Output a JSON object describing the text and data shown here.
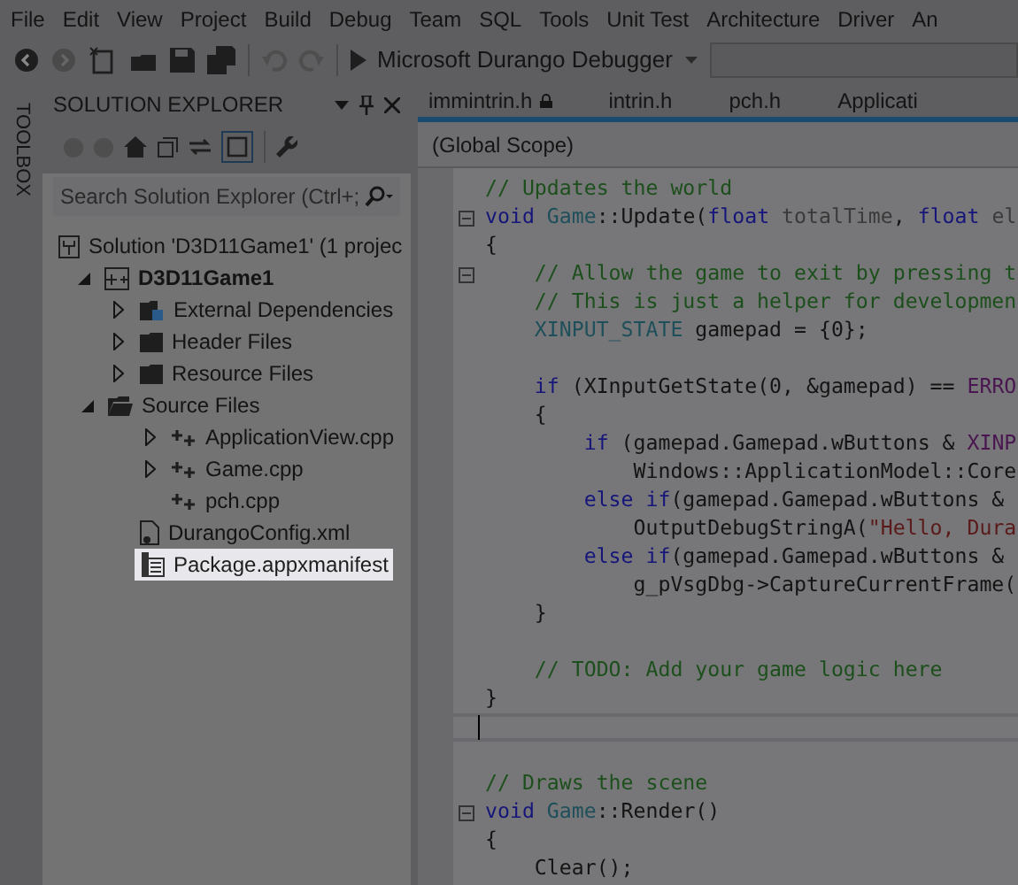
{
  "menu": [
    "File",
    "Edit",
    "View",
    "Project",
    "Build",
    "Debug",
    "Team",
    "SQL",
    "Tools",
    "Unit Test",
    "Architecture",
    "Driver",
    "An"
  ],
  "toolbar": {
    "debugger": "Microsoft Durango Debugger"
  },
  "toolbox": {
    "label": "TOOLBOX"
  },
  "solution_explorer": {
    "title": "SOLUTION EXPLORER",
    "search": {
      "placeholder": "Search Solution Explorer (Ctrl+;"
    },
    "tree": [
      {
        "kind": "solution",
        "label": "Solution 'D3D11Game1' (1 projec",
        "selected": false
      },
      {
        "kind": "project",
        "label": "D3D11Game1",
        "expanded": true,
        "selected": false,
        "children": [
          {
            "kind": "refs",
            "label": "External Dependencies",
            "expanded": false,
            "selected": false
          },
          {
            "kind": "folder",
            "label": "Header Files",
            "expanded": false,
            "selected": false
          },
          {
            "kind": "folder",
            "label": "Resource Files",
            "expanded": false,
            "selected": false
          },
          {
            "kind": "folder",
            "label": "Source Files",
            "expanded": true,
            "selected": false,
            "children": [
              {
                "kind": "cpp",
                "label": "ApplicationView.cpp",
                "expanded": false,
                "selected": false
              },
              {
                "kind": "cpp",
                "label": "Game.cpp",
                "expanded": false,
                "selected": false
              },
              {
                "kind": "cpp",
                "label": "pch.cpp",
                "selected": false
              }
            ]
          },
          {
            "kind": "xml",
            "label": "DurangoConfig.xml",
            "selected": false
          },
          {
            "kind": "manifest",
            "label": "Package.appxmanifest",
            "selected": true
          }
        ]
      }
    ]
  },
  "editor": {
    "tabs": [
      {
        "label": "immintrin.h",
        "locked": true
      },
      {
        "label": "intrin.h",
        "locked": false
      },
      {
        "label": "pch.h",
        "locked": false
      },
      {
        "label": "Applicati",
        "locked": false
      }
    ],
    "scope": "(Global Scope)",
    "lines": [
      {
        "fold": false,
        "tokens": [
          {
            "kind": "comment",
            "text": "// Updates the world"
          }
        ]
      },
      {
        "fold": true,
        "tokens": [
          {
            "kind": "keyword",
            "text": "void"
          },
          {
            "kind": "type",
            "text": " Game"
          },
          {
            "kind": "plain",
            "text": "::Update("
          },
          {
            "kind": "keyword",
            "text": "float"
          },
          {
            "kind": "param",
            "text": " totalTime"
          },
          {
            "kind": "plain",
            "text": ", "
          },
          {
            "kind": "keyword",
            "text": "float"
          },
          {
            "kind": "param",
            "text": " el"
          }
        ]
      },
      {
        "fold": false,
        "tokens": [
          {
            "kind": "plain",
            "text": "{"
          }
        ]
      },
      {
        "fold": true,
        "tokens": [
          {
            "kind": "comment",
            "text": "    // Allow the game to exit by pressing t"
          }
        ]
      },
      {
        "fold": false,
        "tokens": [
          {
            "kind": "comment",
            "text": "    // This is just a helper for developmen"
          }
        ]
      },
      {
        "fold": false,
        "tokens": [
          {
            "kind": "type",
            "text": "    XINPUT_STATE"
          },
          {
            "kind": "plain",
            "text": " gamepad = {0};"
          }
        ]
      },
      {
        "fold": false
      },
      {
        "fold": false,
        "tokens": [
          {
            "kind": "keyword",
            "text": "    if"
          },
          {
            "kind": "plain",
            "text": " (XInputGetState(0, &gamepad) == "
          },
          {
            "kind": "macro",
            "text": "ERRO"
          }
        ]
      },
      {
        "fold": false,
        "tokens": [
          {
            "kind": "plain",
            "text": "    {"
          }
        ]
      },
      {
        "fold": false,
        "tokens": [
          {
            "kind": "keyword",
            "text": "        if"
          },
          {
            "kind": "plain",
            "text": " (gamepad.Gamepad.wButtons & "
          },
          {
            "kind": "macro",
            "text": "XINP"
          }
        ]
      },
      {
        "fold": false,
        "tokens": [
          {
            "kind": "plain",
            "text": "            Windows::ApplicationModel::Core"
          }
        ]
      },
      {
        "fold": false,
        "tokens": [
          {
            "kind": "keyword",
            "text": "        else if"
          },
          {
            "kind": "plain",
            "text": "(gamepad.Gamepad.wButtons &"
          }
        ]
      },
      {
        "fold": false,
        "tokens": [
          {
            "kind": "plain",
            "text": "            OutputDebugStringA("
          },
          {
            "kind": "string",
            "text": "\"Hello, Dura"
          }
        ]
      },
      {
        "fold": false,
        "tokens": [
          {
            "kind": "keyword",
            "text": "        else if"
          },
          {
            "kind": "plain",
            "text": "(gamepad.Gamepad.wButtons &"
          }
        ]
      },
      {
        "fold": false,
        "tokens": [
          {
            "kind": "plain",
            "text": "            g_pVsgDbg->CaptureCurrentFrame("
          }
        ]
      },
      {
        "fold": false,
        "tokens": [
          {
            "kind": "plain",
            "text": "    }"
          }
        ]
      },
      {
        "fold": false
      },
      {
        "fold": false,
        "tokens": [
          {
            "kind": "comment",
            "text": "    // TODO: Add your game logic here"
          }
        ]
      },
      {
        "fold": false,
        "tokens": [
          {
            "kind": "plain",
            "text": "}"
          }
        ]
      },
      {
        "fold": false,
        "current": true
      },
      {
        "fold": false
      },
      {
        "fold": false,
        "tokens": [
          {
            "kind": "comment",
            "text": "// Draws the scene"
          }
        ]
      },
      {
        "fold": true,
        "tokens": [
          {
            "kind": "keyword",
            "text": "void"
          },
          {
            "kind": "type",
            "text": " Game"
          },
          {
            "kind": "plain",
            "text": "::Render()"
          }
        ]
      },
      {
        "fold": false,
        "tokens": [
          {
            "kind": "plain",
            "text": "{"
          }
        ]
      },
      {
        "fold": false,
        "tokens": [
          {
            "kind": "plain",
            "text": "    Clear();"
          }
        ]
      }
    ]
  }
}
